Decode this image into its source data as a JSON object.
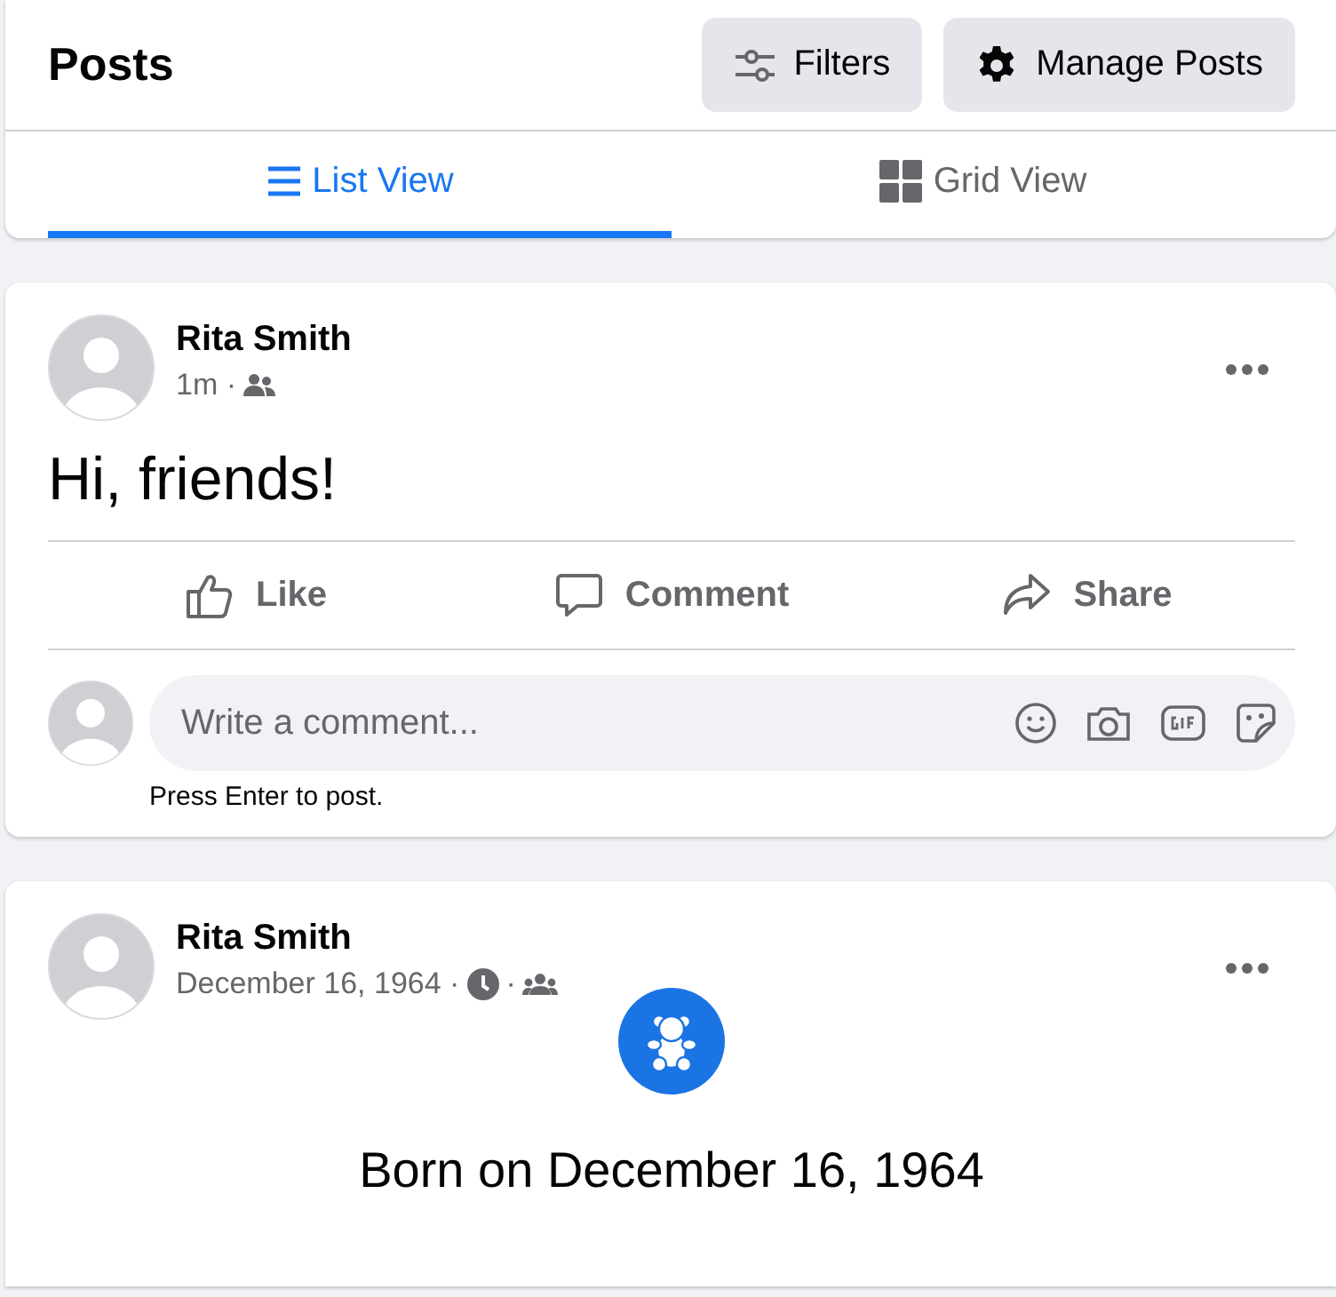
{
  "header": {
    "title": "Posts",
    "buttons": [
      {
        "kind": "filters",
        "label": "Filters"
      },
      {
        "kind": "manage",
        "label": "Manage Posts"
      }
    ]
  },
  "tabs": [
    {
      "kind": "list",
      "label": "List View",
      "selected": true
    },
    {
      "kind": "grid",
      "label": "Grid View",
      "selected": false
    }
  ],
  "posts": [
    {
      "kind": "status",
      "author": "Rita Smith",
      "meta": [
        "1m ·"
      ],
      "text": "Hi, friends!",
      "actions": [
        {
          "kind": "like",
          "label": "Like"
        },
        {
          "kind": "comment",
          "label": "Comment"
        },
        {
          "kind": "share",
          "label": "Share"
        }
      ],
      "comment_box": {
        "placeholder": "Write a comment...",
        "hint": "Press Enter to post."
      }
    },
    {
      "kind": "life_event",
      "author": "Rita Smith",
      "meta": [
        "December 16, 1964 ·",
        "·"
      ],
      "event_text": "Born on December 16, 1964"
    }
  ]
}
